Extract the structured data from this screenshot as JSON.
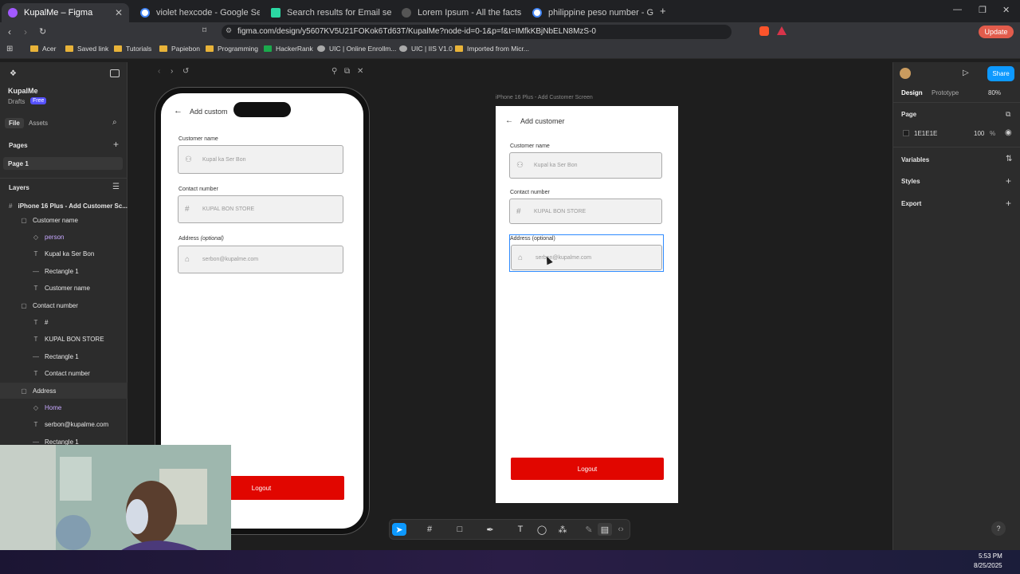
{
  "browser": {
    "tabs": [
      {
        "label": "KupalMe – Figma",
        "color": "#a259ff",
        "active": true
      },
      {
        "label": "violet hexcode - Google Search",
        "color": "#4285f4",
        "active": false
      },
      {
        "label": "Search results for Email send - Flatic",
        "color": "#2bd9a3",
        "active": false
      },
      {
        "label": "Lorem Ipsum - All the facts - Lipsum",
        "color": "#666666",
        "active": false
      },
      {
        "label": "philippine peso number - Google Se",
        "color": "#4285f4",
        "active": false
      }
    ],
    "url": "figma.com/design/y5607KV5U21FOKok6Td63T/KupalMe?node-id=0-1&p=f&t=IMfkKBjNbELN8MzS-0",
    "update_label": "Update",
    "bookmarks": [
      "Acer",
      "Saved link",
      "Tutorials",
      "Papiebon",
      "Programming",
      "HackerRank",
      "UIC | Online Enrollm...",
      "UIC | IIS V1.0",
      "Imported from Micr..."
    ]
  },
  "figma": {
    "file_name": "KupalMe",
    "drafts_label": "Drafts",
    "plan_badge": "Free",
    "tabs": {
      "file": "File",
      "assets": "Assets"
    },
    "pages_label": "Pages",
    "page_1": "Page 1",
    "layers_label": "Layers",
    "layers": [
      {
        "label": "iPhone 16 Plus - Add Customer Sc...",
        "icon": "#",
        "indent": 0,
        "purple": false
      },
      {
        "label": "Customer name",
        "icon": "▢",
        "indent": 1,
        "purple": false
      },
      {
        "label": "person",
        "icon": "◇",
        "indent": 2,
        "purple": true
      },
      {
        "label": "Kupal ka Ser Bon",
        "icon": "T",
        "indent": 2,
        "purple": false
      },
      {
        "label": "Rectangle 1",
        "icon": "—",
        "indent": 2,
        "purple": false
      },
      {
        "label": "Customer name",
        "icon": "T",
        "indent": 2,
        "purple": false
      },
      {
        "label": "Contact number",
        "icon": "▢",
        "indent": 1,
        "purple": false
      },
      {
        "label": "#",
        "icon": "T",
        "indent": 2,
        "purple": false
      },
      {
        "label": "KUPAL BON STORE",
        "icon": "T",
        "indent": 2,
        "purple": false
      },
      {
        "label": "Rectangle 1",
        "icon": "—",
        "indent": 2,
        "purple": false
      },
      {
        "label": "Contact number",
        "icon": "T",
        "indent": 2,
        "purple": false
      },
      {
        "label": "Address",
        "icon": "▢",
        "indent": 1,
        "purple": false
      },
      {
        "label": "Home",
        "icon": "◇",
        "indent": 2,
        "purple": true
      },
      {
        "label": "serbon@kupalme.com",
        "icon": "T",
        "indent": 2,
        "purple": false
      },
      {
        "label": "Rectangle 1",
        "icon": "—",
        "indent": 2,
        "purple": false
      }
    ],
    "frame_label": "iPhone 16 Plus - Add Customer Screen",
    "right_panel": {
      "share": "Share",
      "design_tab": "Design",
      "prototype_tab": "Prototype",
      "zoom": "80%",
      "page_label": "Page",
      "page_color": "1E1E1E",
      "page_opacity": "100",
      "opacity_unit": "%",
      "variables": "Variables",
      "styles": "Styles",
      "export": "Export"
    }
  },
  "app_screen": {
    "title": "Add customer",
    "phone_title": "Add custom",
    "customer_name_label": "Customer name",
    "customer_name_placeholder": "Kupal ka Ser Bon",
    "contact_label": "Contact number",
    "contact_placeholder": "KUPAL BON STORE",
    "address_label": "Address",
    "address_optional": "(optional)",
    "address_label_full": "Address (optional)",
    "address_placeholder": "serbon@kupalme.com",
    "logout": "Logout",
    "hash_glyph": "#"
  },
  "taskbar": {
    "time": "5:53 PM",
    "date": "8/25/2025"
  },
  "help": "?"
}
